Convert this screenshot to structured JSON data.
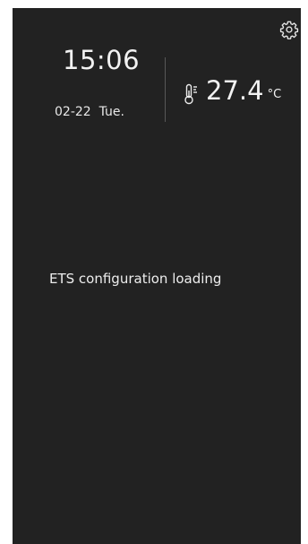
{
  "clock": {
    "time": "15:06",
    "date": "02-22  Tue."
  },
  "temperature": {
    "value": "27.4",
    "unit": "°C"
  },
  "status": {
    "message": "ETS configuration loading"
  },
  "icons": {
    "settings": "gear-icon",
    "thermometer": "thermometer-icon"
  },
  "colors": {
    "screen_background": "#222222",
    "text": "#f2f2f2",
    "divider": "#585858"
  }
}
